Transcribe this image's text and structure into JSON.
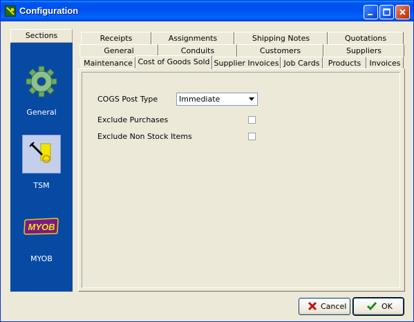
{
  "window": {
    "title": "Configuration"
  },
  "sections": {
    "header": "Sections",
    "items": [
      {
        "label": "General",
        "icon": "gear-icon"
      },
      {
        "label": "TSM",
        "icon": "tsm-icon",
        "selected": true
      },
      {
        "label": "MYOB",
        "icon": "myob-logo",
        "logo_text": "MYOB"
      }
    ]
  },
  "tabs": {
    "row1": [
      "Receipts",
      "Assignments",
      "Shipping Notes",
      "Quotations"
    ],
    "row2": [
      "General",
      "Conduits",
      "Customers",
      "Suppliers"
    ],
    "row3": [
      "Maintenance",
      "Cost of Goods Sold",
      "Supplier Invoices",
      "Job Cards",
      "Products",
      "Invoices"
    ],
    "active": "Cost of Goods Sold"
  },
  "form": {
    "cogs_post_type": {
      "label": "COGS Post Type",
      "value": "Immediate"
    },
    "exclude_purchases": {
      "label": "Exclude Purchases",
      "checked": false
    },
    "exclude_non_stock": {
      "label": "Exclude Non Stock Items",
      "checked": false
    }
  },
  "buttons": {
    "cancel": "Cancel",
    "ok": "OK"
  }
}
